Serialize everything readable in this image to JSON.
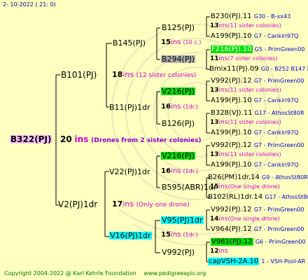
{
  "header": {
    "date": "2- 10-2022",
    "time": "( 21:  0)"
  },
  "footer": {
    "copyright": "Copyright 2004-2022 @ Karl Kehrle Foundation",
    "site": "www.pedigreeapis.org"
  },
  "colors": {
    "green": "#00dd00",
    "cyan": "#00ffff",
    "gray": "#b0b0b0",
    "violet": "#ffc0ff",
    "magenta": "#cc00cc",
    "blue": "#0000cc"
  },
  "tree": {
    "root": {
      "name": "B322(PJ)",
      "num": "20",
      "ins": "ins",
      "note": "(Drones from 2 sister colonies)"
    },
    "g1": [
      {
        "name": "B101(PJ)",
        "num": "18",
        "ins": "ins",
        "note": "(12 sister colonies)"
      },
      {
        "name": "V2(PJ)1dr",
        "num": "17",
        "ins": "ins",
        "note": "(Only one drone)"
      }
    ],
    "g2": [
      {
        "name": "B145(PJ)",
        "num": "15",
        "ins": "ins",
        "note": "(10 c.)"
      },
      {
        "name": "B11(PJ)1dr",
        "num": "16",
        "ins": "ins",
        "note": "(1dr.)"
      },
      {
        "name": "V22(PJ)1dr",
        "num": "16",
        "ins": "ins",
        "note": "(1dr.)"
      },
      {
        "name": "V16(PJ)1dr",
        "num": "15",
        "ins": "ins",
        "note": "(1dr.)"
      }
    ],
    "g3": [
      {
        "name": "B125(PJ)",
        "num": "13",
        "ins": "ins",
        "note": "(11 sister colonies)"
      },
      {
        "name": "B294(PJ)",
        "num": "11",
        "ins": "ins",
        "note": "(7 sister colonies)"
      },
      {
        "name": "V216(PJ)",
        "num": "13",
        "ins": "ins",
        "note": "(11 sister colonies)"
      },
      {
        "name": "B126(PJ)",
        "num": "13",
        "ins": "ins",
        "note": "(11 sister colonies)"
      },
      {
        "name": "V216(PJ)",
        "num": "13",
        "ins": "ins",
        "note": "(11 sister colonies)"
      },
      {
        "name": "B595(ABR)1dr",
        "num": "15",
        "ins": "ins",
        "note": "(One single drone)"
      },
      {
        "name": "V95(PJ)1dr",
        "num": "14",
        "ins": "ins",
        "note": "(One single drone)"
      },
      {
        "name": "V992(PJ)",
        "num": "12",
        "ins": "ins",
        "note": ""
      }
    ],
    "g4": [
      {
        "name": "B230(PJ).11",
        "ref": "G30 - B-xx43"
      },
      {
        "name": "A199(PJ).10",
        "ref": "G7 - Cankiri97Q"
      },
      {
        "name": "F216(PJ).10",
        "ref": "G5 - PrimGreen00"
      },
      {
        "name": "Bmix11(PJ).09",
        "ref": "G0 - B252 B147 B"
      },
      {
        "name": "V992(PJ).12",
        "ref": "G7 - PrimGreen00"
      },
      {
        "name": "A199(PJ).10",
        "ref": "G7 - Cankiri97Q"
      },
      {
        "name": "B328(VJ).11",
        "ref": "G17 - AthosSt80R"
      },
      {
        "name": "A199(PJ).10",
        "ref": "G7 - Cankiri97Q"
      },
      {
        "name": "V992(PJ).12",
        "ref": "G7 - PrimGreen00"
      },
      {
        "name": "A199(PJ).10",
        "ref": "G7 - Cankiri97Q"
      },
      {
        "name": "B26(PM)1dr.14",
        "ref": "G9 - AthosSt80R"
      },
      {
        "name": "B102(RL)1dr.14",
        "ref": "G17 - AthosSt80R"
      },
      {
        "name": "V992(PJ).12",
        "ref": "G7 - PrimGreen00"
      },
      {
        "name": "V964(PJ).12",
        "ref": "G7 - PrimGreen00"
      },
      {
        "name": "V961(PJ).12",
        "ref": "G6 - PrimGreen00"
      },
      {
        "name": "capVSH-2A.10",
        "ref": "1 - VSH-Pool-AR"
      }
    ]
  }
}
